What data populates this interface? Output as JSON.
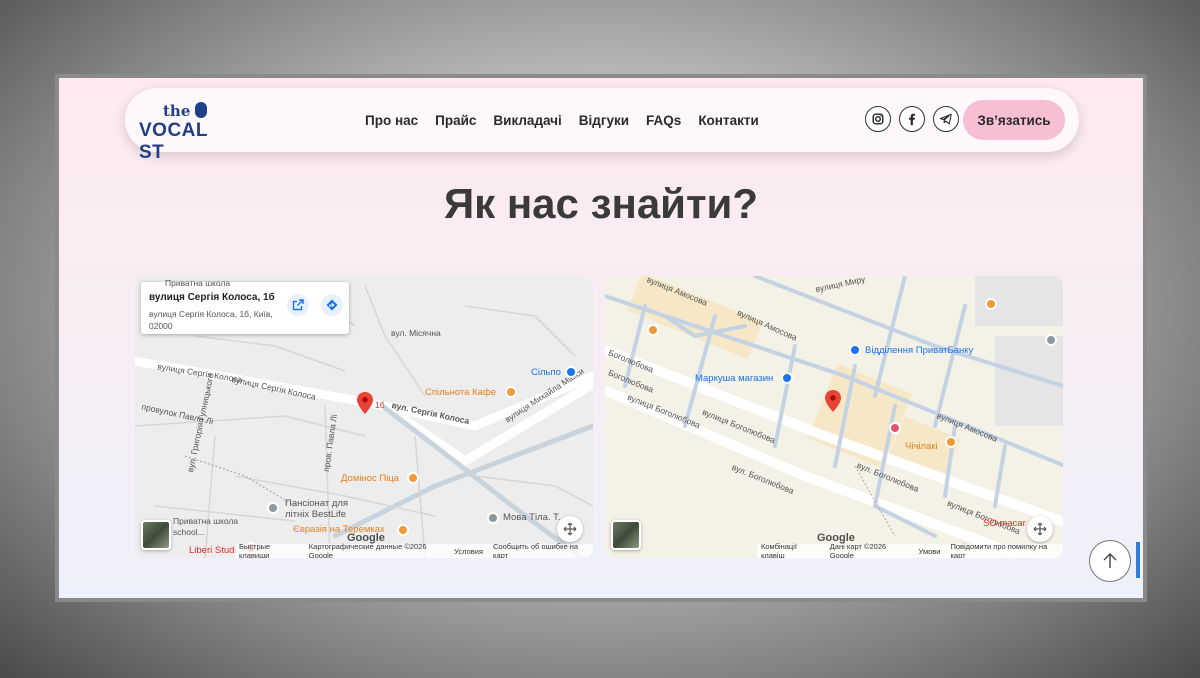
{
  "logo": {
    "the": "the",
    "brand": "VOCAL ST"
  },
  "nav": [
    "Про нас",
    "Прайс",
    "Викладачі",
    "Відгуки",
    "FAQs",
    "Контакти"
  ],
  "social": [
    "instagram-icon",
    "facebook-icon",
    "telegram-icon"
  ],
  "cta": "Зв’язатись",
  "title": "Як нас знайти?",
  "map1": {
    "card": {
      "title": "вулиця Сергія Колоса, 1б",
      "subtitle": "вулиця Сергія Колоса, 1б, Київ, 02000"
    },
    "labels": {
      "school_top": "Приватна школа",
      "misyachna": "вул. Місячна",
      "kolosa_main1": "вулиця Сергія Колоса",
      "kolosa_main2": "вулиця Сергія Колоса",
      "kolosa_short": "вул. Сергія Колоса",
      "pin_num": "1б",
      "provulok": "провулок Павла Лі",
      "hulnytskoho": "вул. Григорія Гулницького",
      "pavla": "пров. Павла Лі",
      "maksymovycha": "вулиця Михайла Макси",
      "school_bottom": "Приватна школа",
      "school_bottom2": "school..."
    },
    "pois": {
      "silpo": "Сільпо",
      "spilnota": "Спільнота Кафе",
      "dominos": "Домінос Піца",
      "pansionat": "Пансіонат для літніх BestLife",
      "evraziya": "Євразія на Теремках",
      "mova": "Мова Тіла. Т...",
      "liberi": "Liberi Studi"
    },
    "attribution": [
      "Быстрые клавиши",
      "Картографические данные ©2026 Google",
      "Условия",
      "Сообщить об ошибке на карт"
    ]
  },
  "map2": {
    "labels": {
      "amosova_top": "вулиця Амосова",
      "amosova_mid": "вулиця Амосова",
      "myru": "вулиця Миру",
      "boholiubova_l": "Боголюбова",
      "boholiubova_l2": "Боголюбова",
      "boholiubova1": "вулиця Боголюбова",
      "boholiubova2": "вулиця Боголюбова",
      "boholiubova3": "вул. Боголюбова",
      "boholiubova4": "вул. Боголюбова",
      "boholiubova5": "вулиця Боголюбова",
      "amosova_right": "вулиця Амосова"
    },
    "pois": {
      "privat": "Відділення ПриватБанку",
      "markusha": "Маркуша магазин",
      "chichilaki": "Чічілакі",
      "so": "SO macar"
    },
    "attribution": [
      "Комбінації клавіш",
      "Дані карт ©2026 Google",
      "Умови",
      "Повідомити про помилку на карт"
    ]
  },
  "google_label": "Google"
}
